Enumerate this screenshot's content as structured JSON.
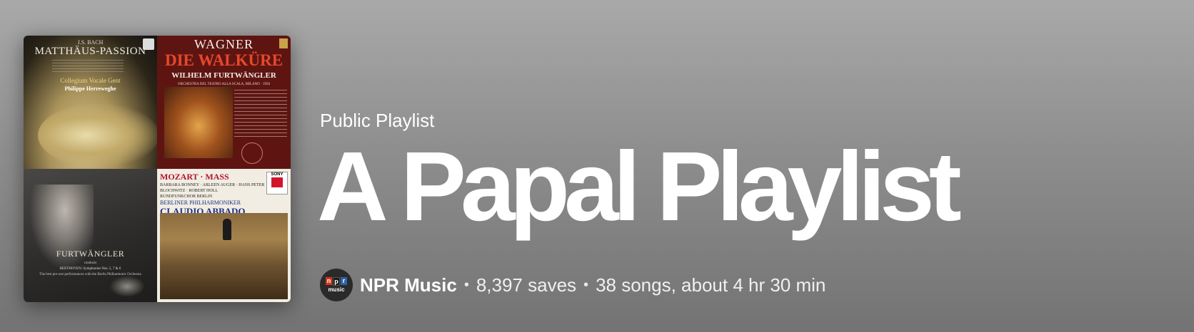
{
  "header": {
    "type_label": "Public Playlist",
    "title": "A Papal Playlist",
    "owner": "NPR Music",
    "separator": "•",
    "saves": "8,397 saves",
    "summary": "38 songs, about 4 hr 30 min"
  },
  "avatar": {
    "logo_letters": [
      "n",
      "p",
      "r"
    ],
    "logo_sub": "music",
    "colors": {
      "n": "#d6361b",
      "p": "#1a1a1a",
      "r": "#2e63ad"
    }
  },
  "cover": {
    "tile1": {
      "composer": "J.S. BACH",
      "title": "MATTHÄUS-PASSION",
      "ensemble": "Collegium Vocale Gent",
      "conductor": "Philippe Herreweghe"
    },
    "tile2": {
      "composer": "WAGNER",
      "title": "DIE WALKÜRE",
      "conductor": "WILHELM FURTWÄNGLER",
      "orchestra": "ORCHESTRA DEL TEATRO ALLA SCALA, MILANO · 1950"
    },
    "tile3": {
      "conductor": "FURTWÄNGLER",
      "conducts": "conducts",
      "works": "BEETHOVEN: Symphonies Nos. 5, 7 & 6",
      "note": "The best pre-war performances with the Berlin Philharmonic Orchestra"
    },
    "tile4": {
      "title": "MOZART · MASS",
      "soloists": "BARBARA BONNEY · ARLEEN AUGER · HANS PETER BLOCHWITZ · ROBERT HOLL",
      "choir": "RUNDFUNKCHOR BERLIN",
      "orchestra": "BERLINER PHILHARMONIKER",
      "conductor": "CLAUDIO ABBADO",
      "label": "SONY"
    }
  },
  "colors": {
    "background_top": "#a9a9a9",
    "background_bottom": "#737373",
    "text": "#ffffff"
  }
}
